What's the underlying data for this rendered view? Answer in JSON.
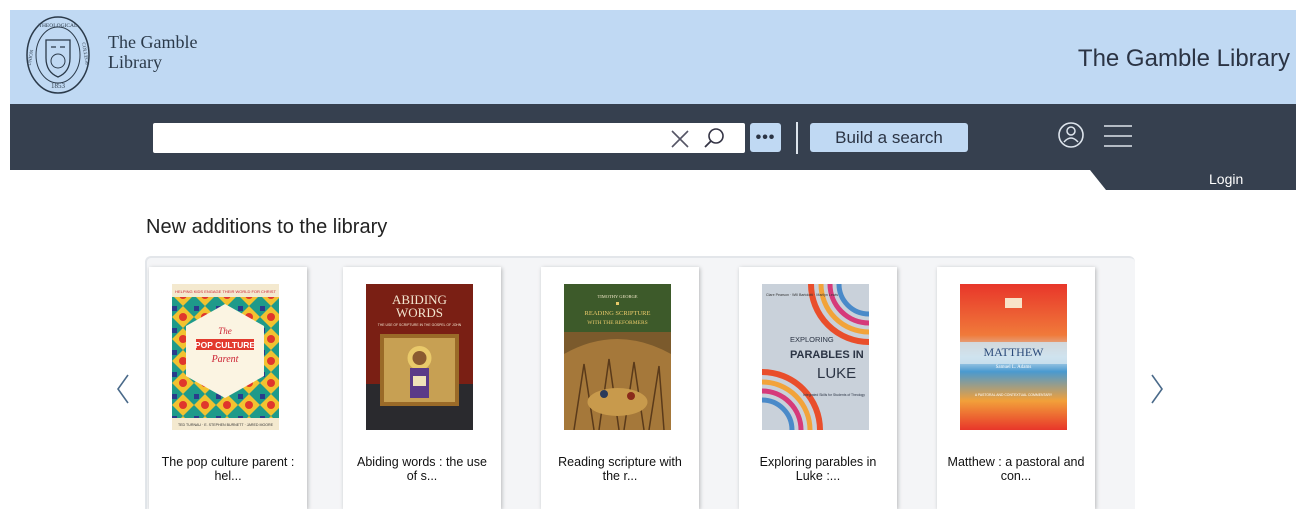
{
  "header": {
    "logo_line1": "The Gamble",
    "logo_line2": "Library",
    "site_title": "The Gamble Library",
    "seal_text_top": "THEOLOGICAL",
    "seal_text_left": "UNION",
    "seal_text_right": "COLLEGE",
    "seal_year": "1853"
  },
  "search": {
    "value": "",
    "placeholder": "",
    "more_label": "•••",
    "build_label": "Build a search"
  },
  "account": {
    "login_label": "Login"
  },
  "colors": {
    "header_bg": "#c0d9f3",
    "navbar_bg": "#36404f",
    "button_bg": "#c0d9f3"
  },
  "main": {
    "section_title": "New additions to the library",
    "books": [
      {
        "title": "The pop culture parent :",
        "title2": "hel...",
        "cover_top": "HELPING KIDS ENGAGE THEIR WORLD FOR CHRIST",
        "cover_heading1": "The",
        "cover_heading2": "POP CULTURE",
        "cover_heading3": "Parent",
        "cover_authors": "TED TURNAU · E. STEPHEN BURNETT · JARED MOORE"
      },
      {
        "title": "Abiding words : the use",
        "title2": "of s...",
        "cover_heading1": "ABIDING",
        "cover_heading2": "WORDS",
        "cover_sub": "THE USE OF SCRIPTURE IN THE GOSPEL OF JOHN"
      },
      {
        "title": "Reading scripture with",
        "title2": "the r...",
        "cover_author": "TIMOTHY GEORGE",
        "cover_heading1": "READING SCRIPTURE",
        "cover_heading2": "WITH THE REFORMERS"
      },
      {
        "title": "Exploring parables in",
        "title2": "Luke :...",
        "cover_authors": "Clare Pearson · Will Bartolotti · Marilyn Lewis",
        "cover_heading1": "EXPLORING",
        "cover_heading2": "PARABLES IN",
        "cover_heading3": "LUKE",
        "cover_sub": "Integrated Skills for Students of Theology"
      },
      {
        "title": "Matthew : a pastoral and",
        "title2": "con...",
        "cover_heading1": "MATTHEW",
        "cover_author": "Samuel L. Adams",
        "cover_sub": "A PASTORAL AND CONTEXTUAL COMMENTARY"
      }
    ]
  }
}
